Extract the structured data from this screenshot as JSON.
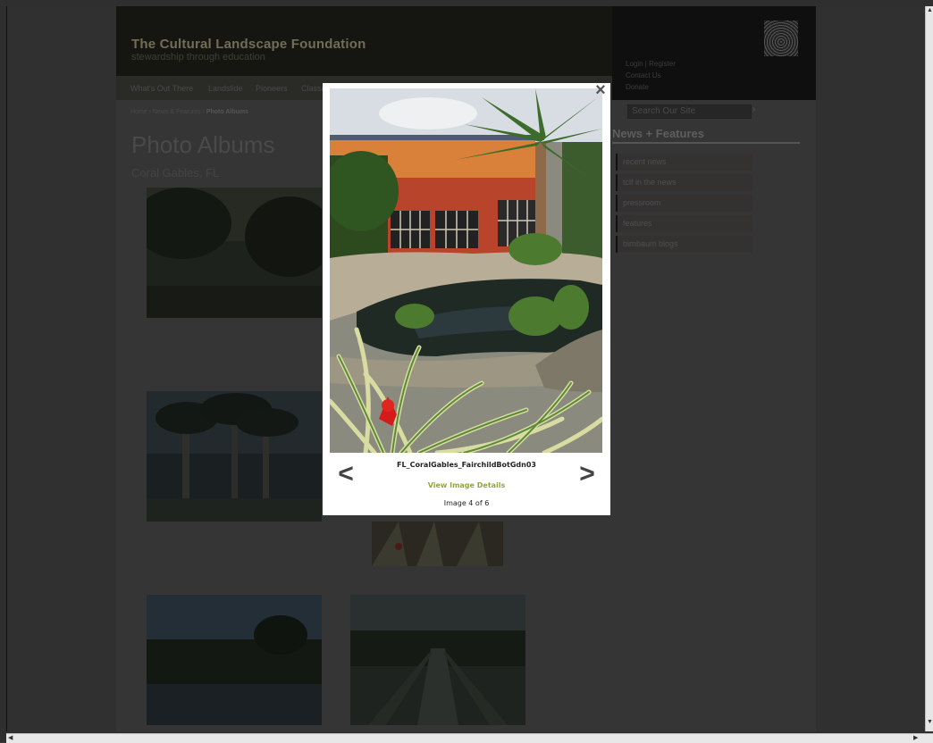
{
  "site": {
    "title": "The Cultural Landscape Foundation",
    "tagline": "stewardship through education",
    "utility_links": [
      "Login | Register",
      "Contact Us",
      "Donate"
    ],
    "nav": [
      "What's Out There",
      "Landslide",
      "Pioneers",
      "Classroom"
    ],
    "breadcrumb": {
      "trail": "Home › News & Features › ",
      "current": "Photo Albums"
    },
    "page_title": "Photo Albums",
    "subtitle": "Coral Gables, FL",
    "search_placeholder": "Search Our Site",
    "search_go": "›",
    "news": {
      "heading": "News + Features",
      "items": [
        "recent news",
        "tclf in the news",
        "pressroom",
        "features",
        "birnbaum blogs"
      ]
    }
  },
  "modal": {
    "close": "×",
    "prev": "<",
    "next": ">",
    "image_name": "FL_CoralGables_FairchildBotGdn03",
    "details_link": "View Image Details",
    "counter": "Image 4 of 6"
  },
  "icons": {
    "close": "close-icon",
    "prev": "chevron-left-icon",
    "next": "chevron-right-icon",
    "logo": "fingerprint-logo-icon"
  },
  "colors": {
    "overlay": "#303030",
    "details_link": "#94a63a",
    "modal_bg": "#ffffff"
  }
}
